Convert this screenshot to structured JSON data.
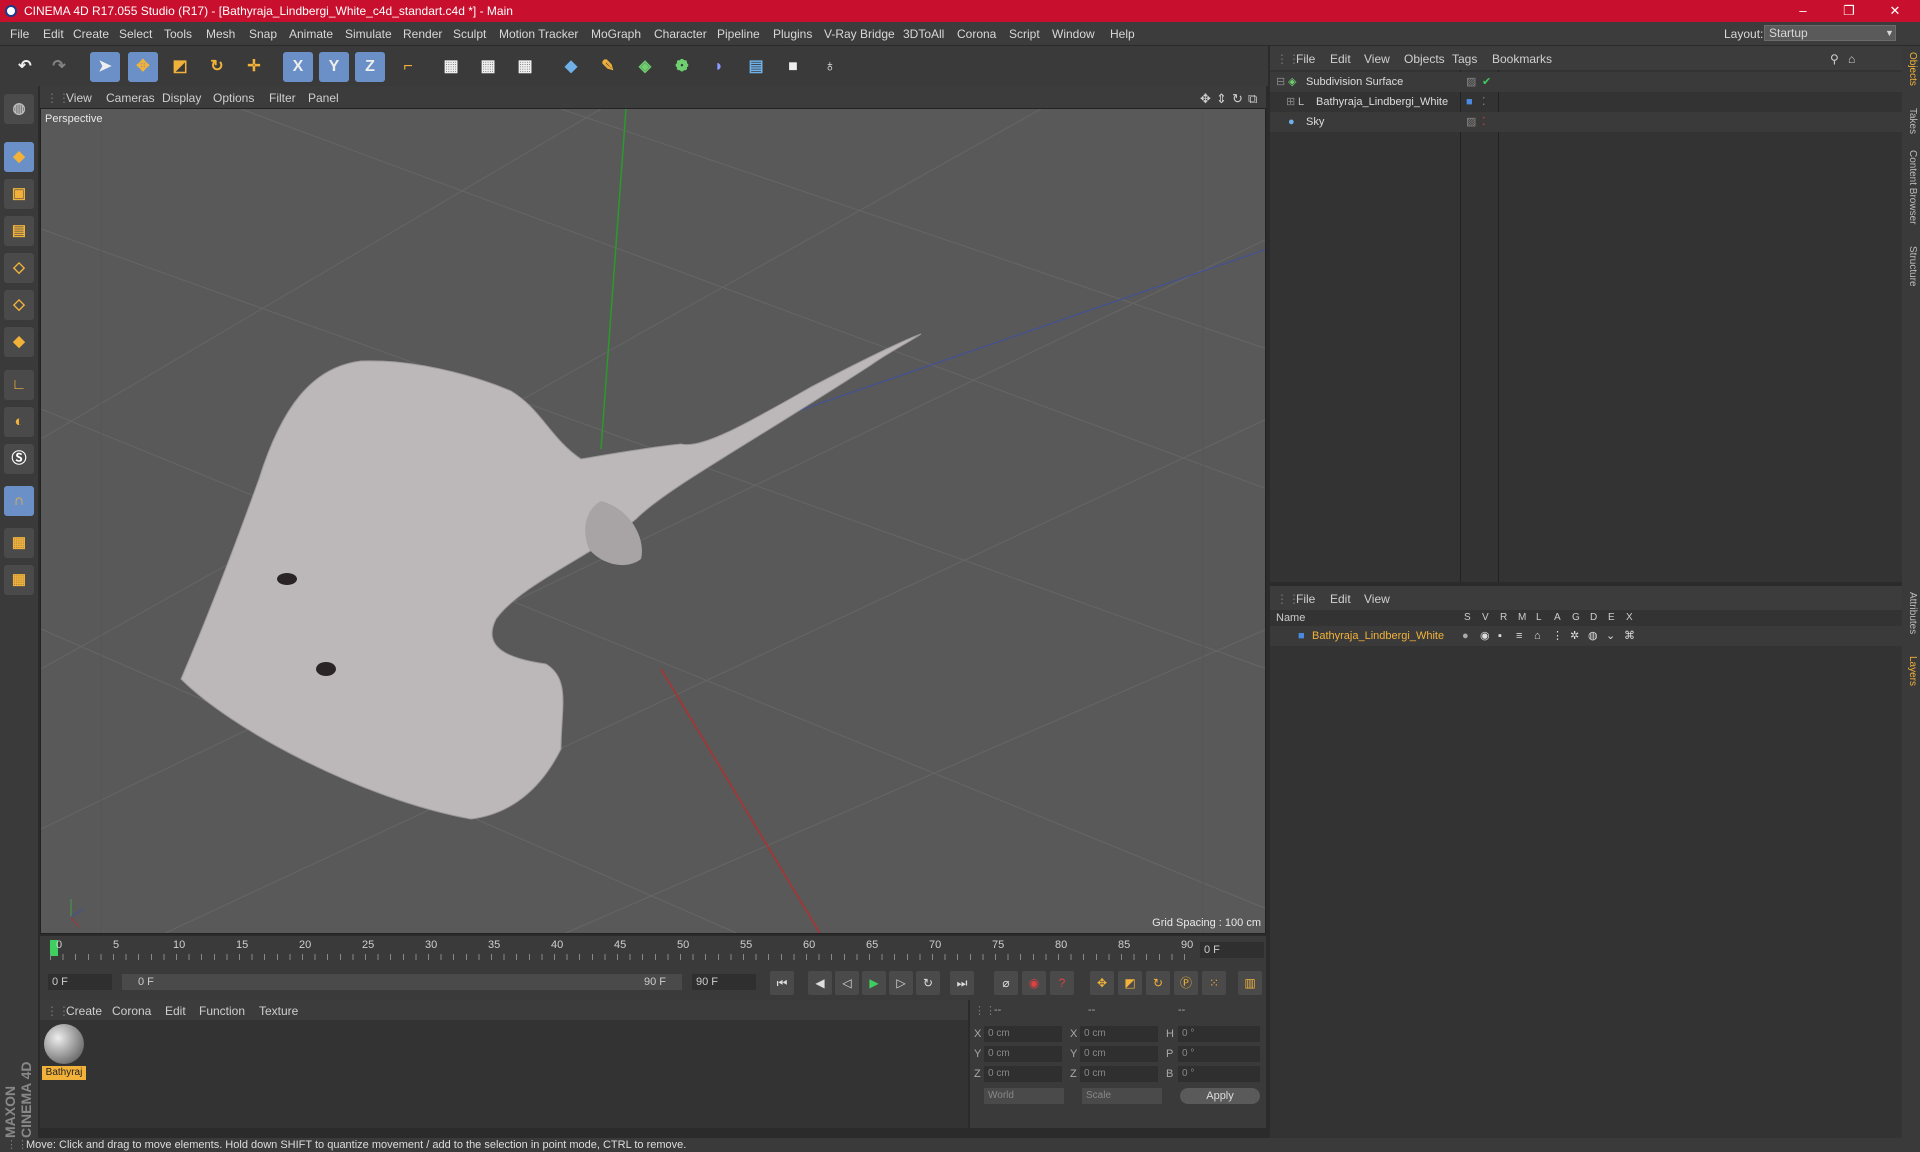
{
  "window": {
    "title": "CINEMA 4D R17.055 Studio (R17) - [Bathyraja_Lindbergi_White_c4d_standart.c4d *] - Main",
    "minimize": "–",
    "maximize": "❐",
    "close": "✕"
  },
  "menubar": {
    "items": [
      "File",
      "Edit",
      "Create",
      "Select",
      "Tools",
      "Mesh",
      "Snap",
      "Animate",
      "Simulate",
      "Render",
      "Sculpt",
      "Motion Tracker",
      "MoGraph",
      "Character",
      "Pipeline",
      "Plugins",
      "V-Ray Bridge",
      "3DToAll",
      "Corona",
      "Script",
      "Window",
      "Help"
    ],
    "layout_label": "Layout:",
    "layout_value": "Startup"
  },
  "toolbar": {
    "axis_x": "X",
    "axis_y": "Y",
    "axis_z": "Z"
  },
  "viewport": {
    "menu": [
      "View",
      "Cameras",
      "Display",
      "Options",
      "Filter",
      "Panel"
    ],
    "label": "Perspective",
    "grid_spacing": "Grid Spacing : 100 cm"
  },
  "timeline": {
    "ticks": [
      "0",
      "5",
      "10",
      "15",
      "20",
      "25",
      "30",
      "35",
      "40",
      "45",
      "50",
      "55",
      "60",
      "65",
      "70",
      "75",
      "80",
      "85",
      "90"
    ],
    "current_frame": "0 F"
  },
  "transport": {
    "start": "0 F",
    "range_start": "0 F",
    "range_end": "90 F",
    "end": "90 F"
  },
  "material": {
    "menu": [
      "Create",
      "Corona",
      "Edit",
      "Function",
      "Texture"
    ],
    "mat_name": "Bathyraj"
  },
  "coords": {
    "header": [
      "--",
      "--",
      "--"
    ],
    "rows": [
      {
        "a": "X",
        "v1": "0 cm",
        "b": "X",
        "v2": "0 cm",
        "c": "H",
        "v3": "0 °"
      },
      {
        "a": "Y",
        "v1": "0 cm",
        "b": "Y",
        "v2": "0 cm",
        "c": "P",
        "v3": "0 °"
      },
      {
        "a": "Z",
        "v1": "0 cm",
        "b": "Z",
        "v2": "0 cm",
        "c": "B",
        "v3": "0 °"
      }
    ],
    "world": "World",
    "scale": "Scale",
    "apply": "Apply"
  },
  "objects": {
    "menu": [
      "File",
      "Edit",
      "View",
      "Objects",
      "Tags",
      "Bookmarks"
    ],
    "items": [
      {
        "name": "Subdivision Surface"
      },
      {
        "name": "Bathyraja_Lindbergi_White"
      },
      {
        "name": "Sky"
      }
    ]
  },
  "layers": {
    "menu": [
      "File",
      "Edit",
      "View"
    ],
    "col_name": "Name",
    "cols": [
      "S",
      "V",
      "R",
      "M",
      "L",
      "A",
      "G",
      "D",
      "E",
      "X"
    ],
    "item": "Bathyraja_Lindbergi_White"
  },
  "sidetabs": [
    "Objects",
    "Takes",
    "Content Browser",
    "Structure",
    "Attributes",
    "Layers"
  ],
  "status": "Move: Click and drag to move elements. Hold down SHIFT to quantize movement / add to the selection in point mode, CTRL to remove.",
  "brand": {
    "line1": "MAXON",
    "line2": "CINEMA 4D"
  }
}
